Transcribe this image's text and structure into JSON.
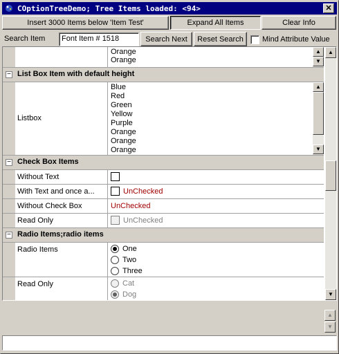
{
  "window": {
    "title": "COptionTreeDemo; Tree Items loaded: <94>",
    "close_label": "✕"
  },
  "toolbar": {
    "insert_label": "Insert 3000 Items below 'Item Test'",
    "expand_label": "Expand All Items",
    "clear_label": "Clear Info"
  },
  "search": {
    "label": "Search Item",
    "value": "Font Item # 1518",
    "next_label": "Search Next",
    "reset_label": "Reset Search",
    "mind_label": "Mind Attribute Value"
  },
  "tree": {
    "top_list": [
      "Orange",
      "Orange"
    ],
    "listbox_section": {
      "title": "List Box Item with default height",
      "item_name": "Listbox",
      "items": [
        "Blue",
        "Red",
        "Green",
        "Yellow",
        "Purple",
        "Orange",
        "Orange",
        "Orange"
      ]
    },
    "checkbox_section": {
      "title": "Check Box Items",
      "rows": [
        {
          "name": "Without Text",
          "value": ""
        },
        {
          "name": "With Text and once a...",
          "value": "UnChecked"
        },
        {
          "name": "Without Check Box",
          "value": "UnChecked"
        },
        {
          "name": "Read Only",
          "value": "UnChecked"
        }
      ]
    },
    "radio_section": {
      "title": "Radio Items;radio items",
      "radio_row": {
        "name": "Radio Items",
        "options": [
          "One",
          "Two",
          "Three"
        ],
        "selected": "One"
      },
      "readonly_row": {
        "name": "Read Only",
        "options": [
          "Cat",
          "Dog"
        ],
        "selected": "Dog"
      }
    }
  },
  "status": {
    "text": ""
  }
}
